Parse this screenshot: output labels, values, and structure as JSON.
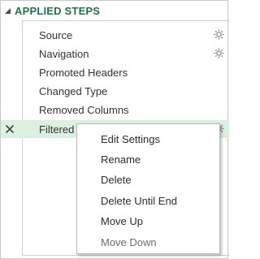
{
  "panel": {
    "title": "APPLIED STEPS"
  },
  "steps": [
    {
      "label": "Source",
      "has_settings": true
    },
    {
      "label": "Navigation",
      "has_settings": true
    },
    {
      "label": "Promoted Headers",
      "has_settings": false
    },
    {
      "label": "Changed Type",
      "has_settings": false
    },
    {
      "label": "Removed Columns",
      "has_settings": false
    },
    {
      "label": "Filtered Rows",
      "has_settings": true,
      "selected": true
    }
  ],
  "context_menu": {
    "items": [
      {
        "label": "Edit Settings"
      },
      {
        "label": "Rename"
      },
      {
        "label": "Delete"
      },
      {
        "label": "Delete Until End"
      },
      {
        "label": "Move Up"
      },
      {
        "label": "Move Down",
        "disabled": true
      }
    ]
  },
  "colors": {
    "title": "#217346",
    "selected_row": "#dcf0e2",
    "text": "#333333",
    "disabled_text": "#6d6d6d"
  },
  "icons": {
    "collapse": "collapse-triangle-icon",
    "settings": "gear-icon",
    "delete_step": "delete-x-icon"
  }
}
